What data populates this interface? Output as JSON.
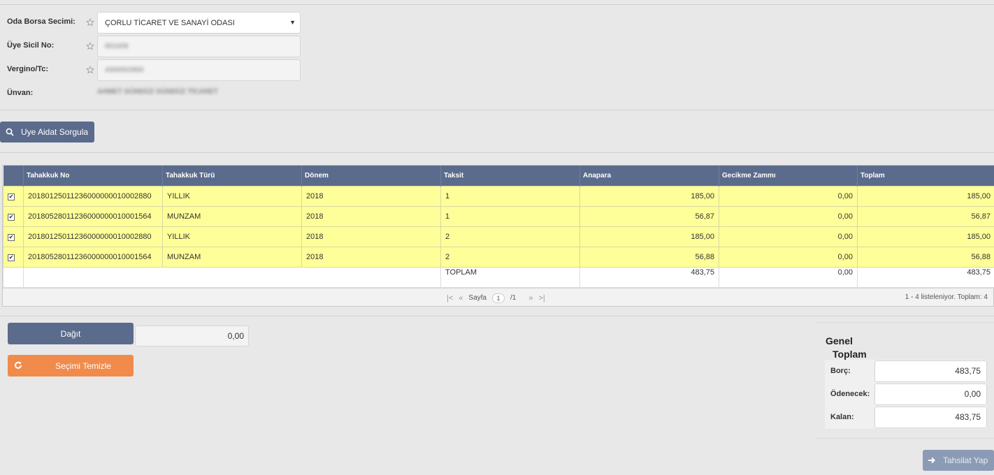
{
  "form": {
    "oda_label": "Oda Borsa Secimi:",
    "oda_value": "ÇORLU TİCARET VE SANAYİ ODASI",
    "sicil_label": "Üye Sicil No:",
    "sicil_value": "001009",
    "vergi_label": "Vergino/Tc:",
    "vergi_value": "4300002950",
    "unvan_label": "Ünvan:",
    "unvan_value": "AHMET GÜNDÜZ GÜNDÜZ TİCARET"
  },
  "query_button": {
    "label": "Uye Aidat Sorgula",
    "icon": "search-icon"
  },
  "grid": {
    "headers": [
      "",
      "Tahakkuk No",
      "Tahakkuk Türü",
      "Dönem",
      "Taksit",
      "Anapara",
      "Gecikme Zammı",
      "Toplam"
    ],
    "rows": [
      {
        "no": "20180125011236000000010002880",
        "tur": "YILLIK",
        "donem": "2018",
        "taksit": "1",
        "anapara": "185,00",
        "gecikme": "0,00",
        "toplam": "185,00",
        "checked": true
      },
      {
        "no": "20180528011236000000010001564",
        "tur": "MUNZAM",
        "donem": "2018",
        "taksit": "1",
        "anapara": "56,87",
        "gecikme": "0,00",
        "toplam": "56,87",
        "checked": true
      },
      {
        "no": "20180125011236000000010002880",
        "tur": "YILLIK",
        "donem": "2018",
        "taksit": "2",
        "anapara": "185,00",
        "gecikme": "0,00",
        "toplam": "185,00",
        "checked": true
      },
      {
        "no": "20180528011236000000010001564",
        "tur": "MUNZAM",
        "donem": "2018",
        "taksit": "2",
        "anapara": "56,88",
        "gecikme": "0,00",
        "toplam": "56,88",
        "checked": true
      }
    ],
    "total": {
      "label": "TOPLAM",
      "anapara": "483,75",
      "gecikme": "0,00",
      "toplam": "483,75"
    },
    "pager": {
      "sayfa_label": "Sayfa",
      "page": "1",
      "of": "/1",
      "info": "1 - 4 listeleniyor. Toplam: 4"
    }
  },
  "actions": {
    "dagit_label": "Dağıt",
    "dagit_value": "0,00",
    "temizle_label": "Seçimi Temizle"
  },
  "totals": {
    "title_line1": "Genel",
    "title_line2": "Toplam",
    "borc_label": "Borç:",
    "borc_value": "483,75",
    "odenecek_label": "Ödenecek:",
    "odenecek_value": "0,00",
    "kalan_label": "Kalan:",
    "kalan_value": "483,75"
  },
  "tahsilat_button": {
    "label": "Tahsilat Yap",
    "icon": "arrow-right-icon"
  },
  "colors": {
    "header_bg": "#5a6b8c",
    "selected_row": "#ffff99",
    "orange": "#f08b4c",
    "disabled_btn": "#8b9bb5"
  }
}
